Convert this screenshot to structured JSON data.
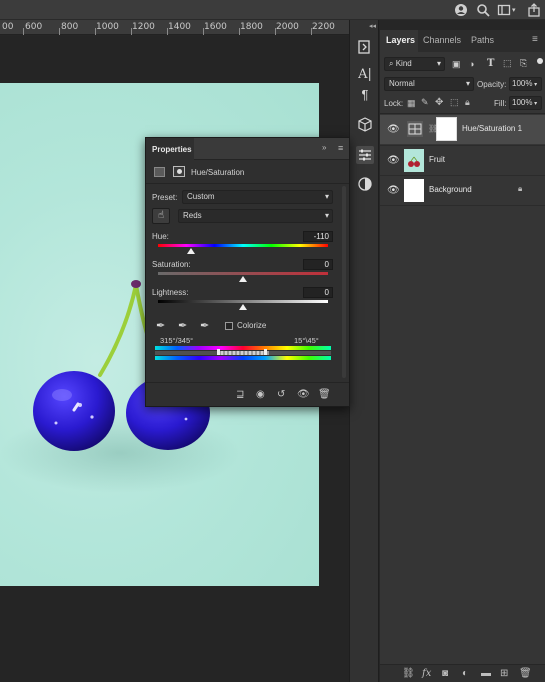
{
  "topbar": {
    "icons": [
      "user-icon",
      "search-icon",
      "workspace-icon",
      "share-icon"
    ]
  },
  "ruler": {
    "labels": [
      "00",
      "600",
      "800",
      "1000",
      "1200",
      "1400",
      "1600",
      "1800",
      "2000",
      "2200"
    ]
  },
  "toolbar": {
    "icons": [
      "history-icon",
      "character-icon",
      "paragraph-icon",
      "3d-icon",
      "adjustments-icon",
      "styles-icon"
    ]
  },
  "layers_panel": {
    "tabs": [
      "Layers",
      "Channels",
      "Paths"
    ],
    "filter_kind": "Kind",
    "blend_mode": "Normal",
    "opacity_label": "Opacity:",
    "opacity_value": "100%",
    "lock_label": "Lock:",
    "fill_label": "Fill:",
    "fill_value": "100%",
    "layers": [
      {
        "name": "Hue/Saturation 1",
        "selected": true
      },
      {
        "name": "Fruit",
        "selected": false
      },
      {
        "name": "Background",
        "selected": false,
        "locked": true
      }
    ],
    "footer_icons": [
      "link-icon",
      "fx-icon",
      "mask-icon",
      "adjustment-icon",
      "group-icon",
      "new-layer-icon",
      "trash-icon"
    ]
  },
  "properties": {
    "title": "Properties",
    "adjustment_name": "Hue/Saturation",
    "preset_label": "Preset:",
    "preset_value": "Custom",
    "channel_value": "Reds",
    "hue_label": "Hue:",
    "hue_value": "-110",
    "saturation_label": "Saturation:",
    "saturation_value": "0",
    "lightness_label": "Lightness:",
    "lightness_value": "0",
    "colorize_label": "Colorize",
    "range_left": "315°/345°",
    "range_right": "15°\\45°",
    "hue_fraction": 0.194,
    "saturation_fraction": 0.5,
    "lightness_fraction": 0.5
  },
  "colors": {
    "accent": "#4b8fd6",
    "cherry": "#2a1ad0",
    "canvas": "#b3e6da"
  }
}
